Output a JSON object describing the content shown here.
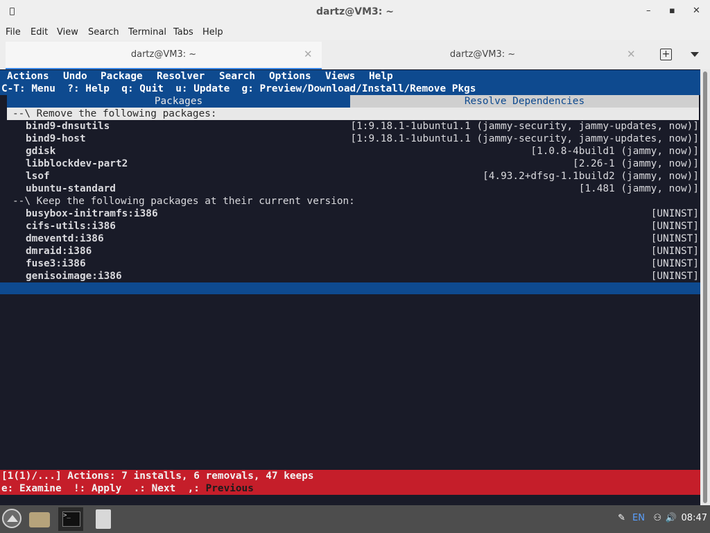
{
  "window": {
    "title": "dartz@VM3: ~",
    "controls": {
      "minimize": "–",
      "maximize": "▪",
      "close": "✕"
    }
  },
  "menubar": [
    "File",
    "Edit",
    "View",
    "Search",
    "Terminal",
    "Tabs",
    "Help"
  ],
  "tabs": [
    {
      "label": "dartz@VM3: ~",
      "active": true
    },
    {
      "label": "dartz@VM3: ~",
      "active": false
    }
  ],
  "tab_close_glyph": "✕",
  "new_tab_glyph": "+",
  "aptitude": {
    "menu": [
      "Actions",
      "Undo",
      "Package",
      "Resolver",
      "Search",
      "Options",
      "Views",
      "Help"
    ],
    "hint": "C-T: Menu  ?: Help  q: Quit  u: Update  g: Preview/Download/Install/Remove Pkgs",
    "view_tabs": [
      "Packages",
      "Resolve Dependencies"
    ],
    "remove_header": "--\\ Remove the following packages:",
    "remove": [
      {
        "name": "bind9-dnsutils",
        "version": "[1:9.18.1-1ubuntu1.1 (jammy-security, jammy-updates, now)]"
      },
      {
        "name": "bind9-host",
        "version": "[1:9.18.1-1ubuntu1.1 (jammy-security, jammy-updates, now)]"
      },
      {
        "name": "gdisk",
        "version": "[1.0.8-4build1 (jammy, now)]"
      },
      {
        "name": "libblockdev-part2",
        "version": "[2.26-1 (jammy, now)]"
      },
      {
        "name": "lsof",
        "version": "[4.93.2+dfsg-1.1build2 (jammy, now)]"
      },
      {
        "name": "ubuntu-standard",
        "version": "[1.481 (jammy, now)]"
      }
    ],
    "keep_header": "--\\ Keep the following packages at their current version:",
    "keep": [
      {
        "name": "busybox-initramfs:i386",
        "version": "[UNINST]"
      },
      {
        "name": "cifs-utils:i386",
        "version": "[UNINST]"
      },
      {
        "name": "dmeventd:i386",
        "version": "[UNINST]"
      },
      {
        "name": "dmraid:i386",
        "version": "[UNINST]"
      },
      {
        "name": "fuse3:i386",
        "version": "[UNINST]"
      },
      {
        "name": "genisoimage:i386",
        "version": "[UNINST]"
      }
    ],
    "status_line": "[1(1)/...] Actions: 7 installs, 6 removals, 47 keeps",
    "status_keys": "e: Examine  !: Apply  .: Next  ,: ",
    "status_prev": "Previous"
  },
  "taskbar": {
    "tray": {
      "lang": "EN",
      "clock": "08:47"
    }
  },
  "colors": {
    "terminal_bg": "#191b28",
    "highlight_blue": "#0e4a8f",
    "status_red": "#c51e2a",
    "accent": "#3584e4"
  }
}
